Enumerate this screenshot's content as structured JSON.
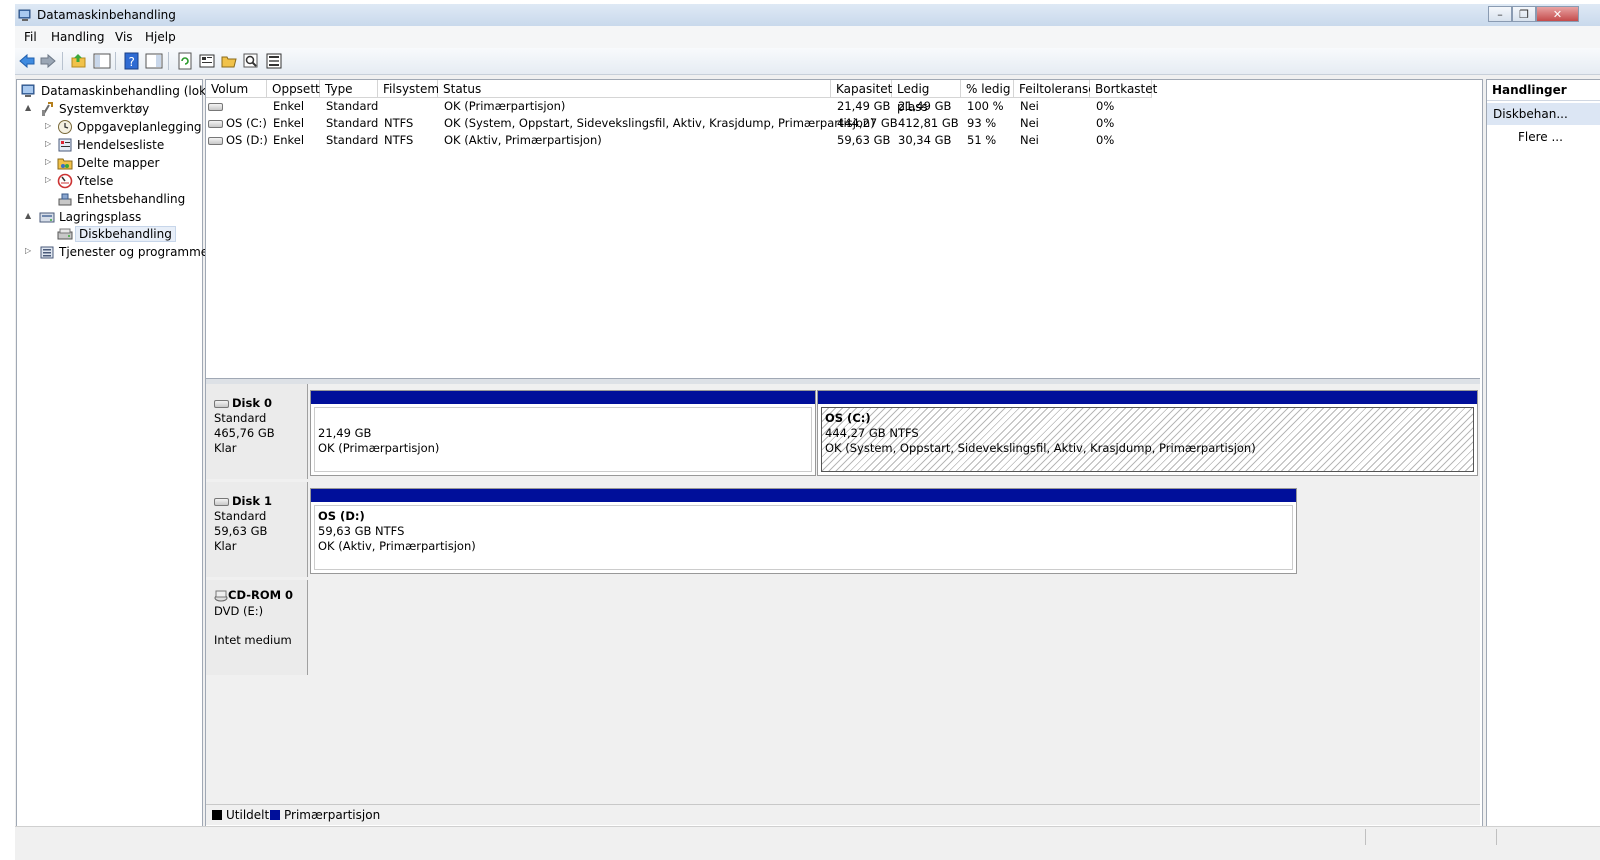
{
  "window": {
    "title": "Datamaskinbehandling",
    "controls": [
      "minimize",
      "restore",
      "close"
    ]
  },
  "menubar": {
    "items": [
      {
        "label": "Fil",
        "mnemonic": "F"
      },
      {
        "label": "Handling",
        "mnemonic": "a"
      },
      {
        "label": "Vis",
        "mnemonic": "V"
      },
      {
        "label": "Hjelp",
        "mnemonic": "H"
      }
    ]
  },
  "toolbar": {
    "buttons": [
      "back-arrow-icon",
      "forward-arrow-icon",
      "up-folder-icon",
      "show-hide-tree-icon",
      "help-icon",
      "show-hide-action-pane-icon",
      "refresh-icon",
      "properties-icon",
      "open-folder-icon",
      "search-icon",
      "settings-icon"
    ]
  },
  "tree": {
    "root": "Datamaskinbehandling (lokal)",
    "items": [
      {
        "label": "Systemverktøy",
        "level": 1,
        "expander": "▲"
      },
      {
        "label": "Oppgaveplanlegging",
        "level": 2,
        "expander": "▷"
      },
      {
        "label": "Hendelsesliste",
        "level": 2,
        "expander": "▷"
      },
      {
        "label": "Delte mapper",
        "level": 2,
        "expander": "▷"
      },
      {
        "label": "Ytelse",
        "level": 2,
        "expander": "▷"
      },
      {
        "label": "Enhetsbehandling",
        "level": 2,
        "expander": ""
      },
      {
        "label": "Lagringsplass",
        "level": 1,
        "expander": "▲"
      },
      {
        "label": "Diskbehandling",
        "level": 2,
        "expander": "",
        "selected": true
      },
      {
        "label": "Tjenester og programmer",
        "level": 1,
        "expander": "▷"
      }
    ]
  },
  "volumes": {
    "columns": [
      "Volum",
      "Oppsett",
      "Type",
      "Filsystem",
      "Status",
      "Kapasitet",
      "Ledig plass",
      "% ledig",
      "Feiltoleranse",
      "Bortkastet"
    ],
    "rows": [
      [
        "",
        "Enkel",
        "Standard",
        "",
        "OK (Primærpartisjon)",
        "21,49 GB",
        "21,49 GB",
        "100 %",
        "Nei",
        "0%"
      ],
      [
        "OS (C:)",
        "Enkel",
        "Standard",
        "NTFS",
        "OK (System, Oppstart, Sidevekslingsfil, Aktiv, Krasjdump, Primærpartisjon)",
        "444,27 GB",
        "412,81 GB",
        "93 %",
        "Nei",
        "0%"
      ],
      [
        "OS (D:)",
        "Enkel",
        "Standard",
        "NTFS",
        "OK (Aktiv, Primærpartisjon)",
        "59,63 GB",
        "30,34 GB",
        "51 %",
        "Nei",
        "0%"
      ]
    ]
  },
  "disks": [
    {
      "name": "Disk 0",
      "type": "Standard",
      "size": "465,76 GB",
      "state": "Klar",
      "partitions": [
        {
          "title": "",
          "line1": "21,49 GB",
          "line2": "OK (Primærpartisjon)"
        },
        {
          "title": "OS  (C:)",
          "line1": "444,27 GB NTFS",
          "line2": "OK (System, Oppstart, Sidevekslingsfil, Aktiv, Krasjdump, Primærpartisjon)"
        }
      ]
    },
    {
      "name": "Disk 1",
      "type": "Standard",
      "size": "59,63 GB",
      "state": "Klar",
      "partitions": [
        {
          "title": "OS  (D:)",
          "line1": "59,63 GB NTFS",
          "line2": "OK (Aktiv, Primærpartisjon)"
        }
      ]
    },
    {
      "name": "CD-ROM 0",
      "type": "DVD (E:)",
      "size": "",
      "state": "Intet medium",
      "partitions": []
    }
  ],
  "legend": [
    {
      "label": "Utildelt",
      "color": "#000000"
    },
    {
      "label": "Primærpartisjon",
      "color": "#000f9a"
    }
  ],
  "actions": {
    "header": "Handlinger",
    "section": "Diskbehan...",
    "more": "Flere ..."
  }
}
